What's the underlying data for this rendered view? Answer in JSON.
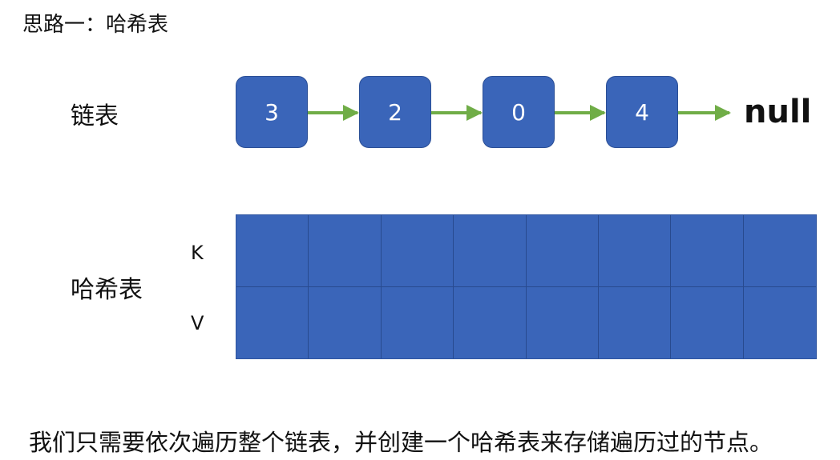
{
  "heading": "思路一：哈希表",
  "linked_list": {
    "label": "链表",
    "nodes": [
      "3",
      "2",
      "0",
      "4"
    ],
    "terminal": "null",
    "node_color": "#3a65b9",
    "arrow_color": "#70ad47"
  },
  "hash_table": {
    "label": "哈希表",
    "key_label": "K",
    "value_label": "V",
    "columns": 8,
    "cell_color": "#3a65b9"
  },
  "caption": "我们只需要依次遍历整个链表，并创建一个哈希表来存储遍历过的节点。"
}
